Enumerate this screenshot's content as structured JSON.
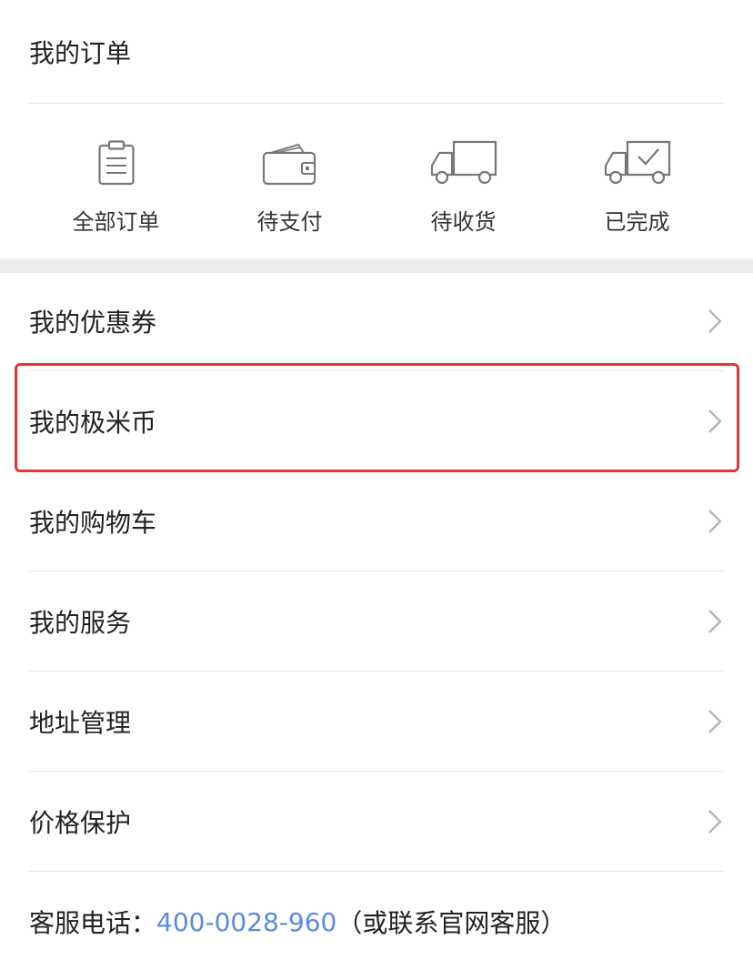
{
  "orders": {
    "title": "我的订单",
    "items": [
      {
        "label": "全部订单",
        "icon": "clipboard-icon"
      },
      {
        "label": "待支付",
        "icon": "wallet-icon"
      },
      {
        "label": "待收货",
        "icon": "truck-icon"
      },
      {
        "label": "已完成",
        "icon": "truck-check-icon"
      }
    ]
  },
  "menu": [
    {
      "label": "我的优惠券"
    },
    {
      "label": "我的极米币"
    },
    {
      "label": "我的购物车"
    },
    {
      "label": "我的服务"
    },
    {
      "label": "地址管理"
    },
    {
      "label": "价格保护"
    }
  ],
  "service": {
    "label": "客服电话：",
    "phone": "400-0028-960",
    "note": "（或联系官网客服）"
  },
  "colors": {
    "accent_link": "#5b8be0",
    "highlight": "#e83434",
    "separator": "#ebebeb"
  }
}
